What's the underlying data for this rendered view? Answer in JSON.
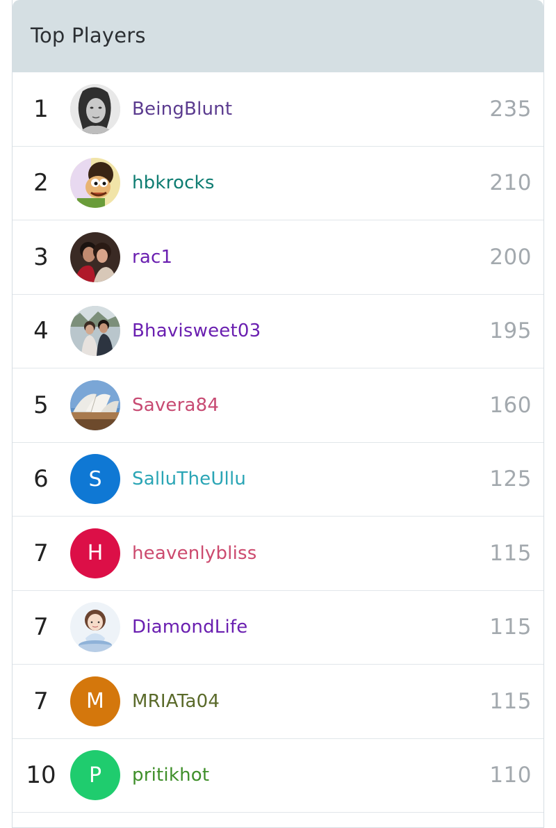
{
  "title": "Top Players",
  "players": [
    {
      "rank": "1",
      "name": "BeingBlunt",
      "score": "235",
      "color": "#5b3b8f",
      "avatar": {
        "type": "photo",
        "icon": "woman-portrait-photo"
      }
    },
    {
      "rank": "2",
      "name": "hbkrocks",
      "score": "210",
      "color": "#0f7d72",
      "avatar": {
        "type": "photo",
        "icon": "cartoon-character-photo"
      }
    },
    {
      "rank": "3",
      "name": "rac1",
      "score": "200",
      "color": "#6a1fb0",
      "avatar": {
        "type": "photo",
        "icon": "couple-photo"
      }
    },
    {
      "rank": "4",
      "name": "Bhavisweet03",
      "score": "195",
      "color": "#6a1fb0",
      "avatar": {
        "type": "photo",
        "icon": "couple-outdoor-photo"
      }
    },
    {
      "rank": "5",
      "name": "Savera84",
      "score": "160",
      "color": "#c74a72",
      "avatar": {
        "type": "photo",
        "icon": "opera-house-photo"
      }
    },
    {
      "rank": "6",
      "name": "SalluTheUllu",
      "score": "125",
      "color": "#2aa5b5",
      "avatar": {
        "type": "letter",
        "letter": "S",
        "bg": "#0f78d4"
      }
    },
    {
      "rank": "7",
      "name": "heavenlybliss",
      "score": "115",
      "color": "#cc4a6e",
      "avatar": {
        "type": "letter",
        "letter": "H",
        "bg": "#dc0f47"
      }
    },
    {
      "rank": "7",
      "name": "DiamondLife",
      "score": "115",
      "color": "#6a1fb0",
      "avatar": {
        "type": "photo",
        "icon": "meditating-girl-illustration"
      }
    },
    {
      "rank": "7",
      "name": "MRIATa04",
      "score": "115",
      "color": "#5a6a2a",
      "avatar": {
        "type": "letter",
        "letter": "M",
        "bg": "#d4770c"
      }
    },
    {
      "rank": "10",
      "name": "pritikhot",
      "score": "110",
      "color": "#3f8f2a",
      "avatar": {
        "type": "letter",
        "letter": "P",
        "bg": "#1fcc6e"
      }
    }
  ]
}
